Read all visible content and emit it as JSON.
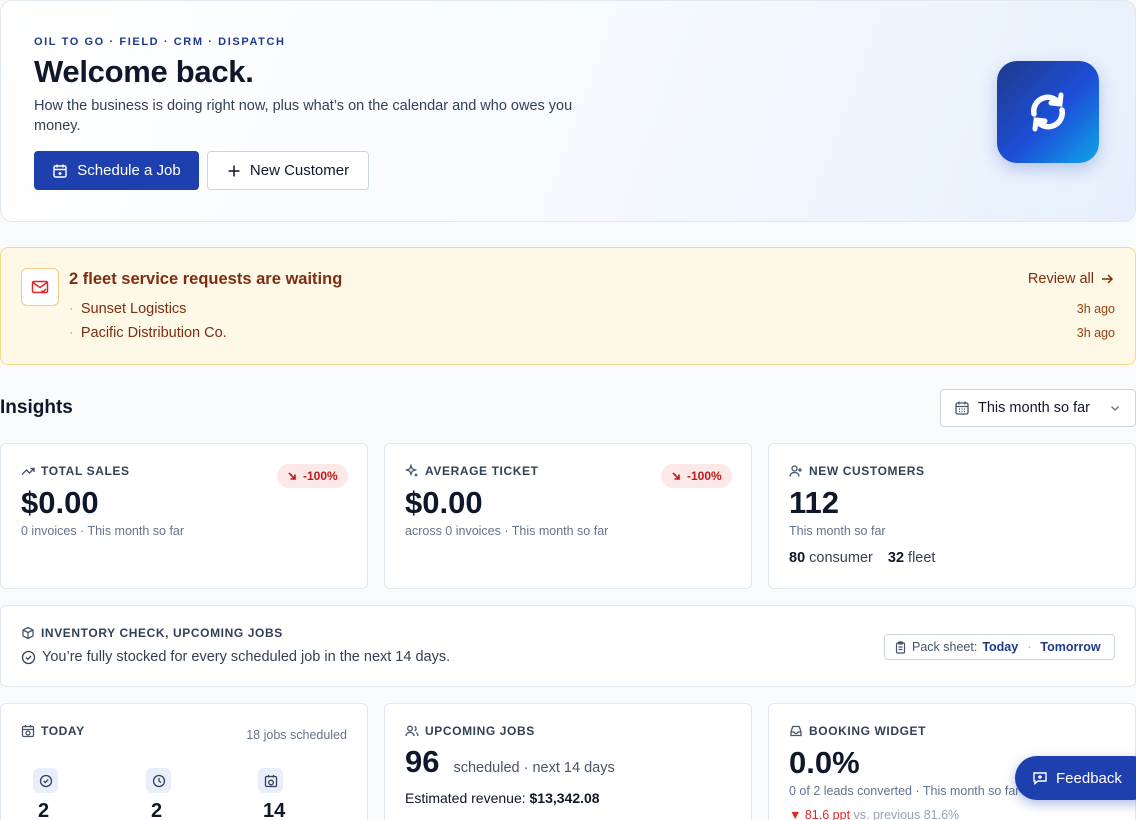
{
  "hero": {
    "eyebrow": "OIL TO GO · FIELD · CRM · DISPATCH",
    "title": "Welcome back.",
    "subtitle": "How the business is doing right now, plus what’s on the calendar and who owes you money.",
    "primary_button": "Schedule a Job",
    "secondary_button": "New Customer",
    "logo_icon": "sync-arrows-icon"
  },
  "alert": {
    "title": "2 fleet service requests are waiting",
    "review_link": "Review all",
    "items": [
      {
        "name": "Sunset Logistics",
        "time": "3h ago"
      },
      {
        "name": "Pacific Distribution Co.",
        "time": "3h ago"
      }
    ]
  },
  "insights": {
    "title": "Insights",
    "range": "This month so far"
  },
  "cards": {
    "total_sales": {
      "label": "TOTAL SALES",
      "value": "$0.00",
      "badge": "-100%",
      "note": "0 invoices · This month so far"
    },
    "average_ticket": {
      "label": "AVERAGE TICKET",
      "value": "$0.00",
      "badge": "-100%",
      "note": "across 0 invoices · This month so far"
    },
    "new_customers": {
      "label": "NEW CUSTOMERS",
      "value": "112",
      "note": "This month so far",
      "consumer_count": "80",
      "consumer_label": "consumer",
      "fleet_count": "32",
      "fleet_label": "fleet"
    }
  },
  "inventory": {
    "label": "INVENTORY CHECK, UPCOMING JOBS",
    "message": "You’re fully stocked for every scheduled job in the next 14 days.",
    "pack_label": "Pack sheet:",
    "pack_today": "Today",
    "pack_tomorrow": "Tomorrow"
  },
  "today": {
    "label": "TODAY",
    "scheduled": "18 jobs scheduled",
    "stats": [
      "2",
      "2",
      "14"
    ]
  },
  "upcoming": {
    "label": "UPCOMING JOBS",
    "value": "96",
    "suffix": "scheduled · next 14 days",
    "revenue_label": "Estimated revenue:",
    "revenue_value": "$13,342.08"
  },
  "booking": {
    "label": "BOOKING WIDGET",
    "value": "0.0%",
    "note": "0 of 2 leads converted · This month so far",
    "trend": "81.6 ppt",
    "trend_note": "vs. previous 81.6%"
  },
  "feedback": "Feedback",
  "colors": {
    "primary": "#1e40af",
    "alert_bg": "#fef9e7",
    "negative": "#dc2626"
  }
}
